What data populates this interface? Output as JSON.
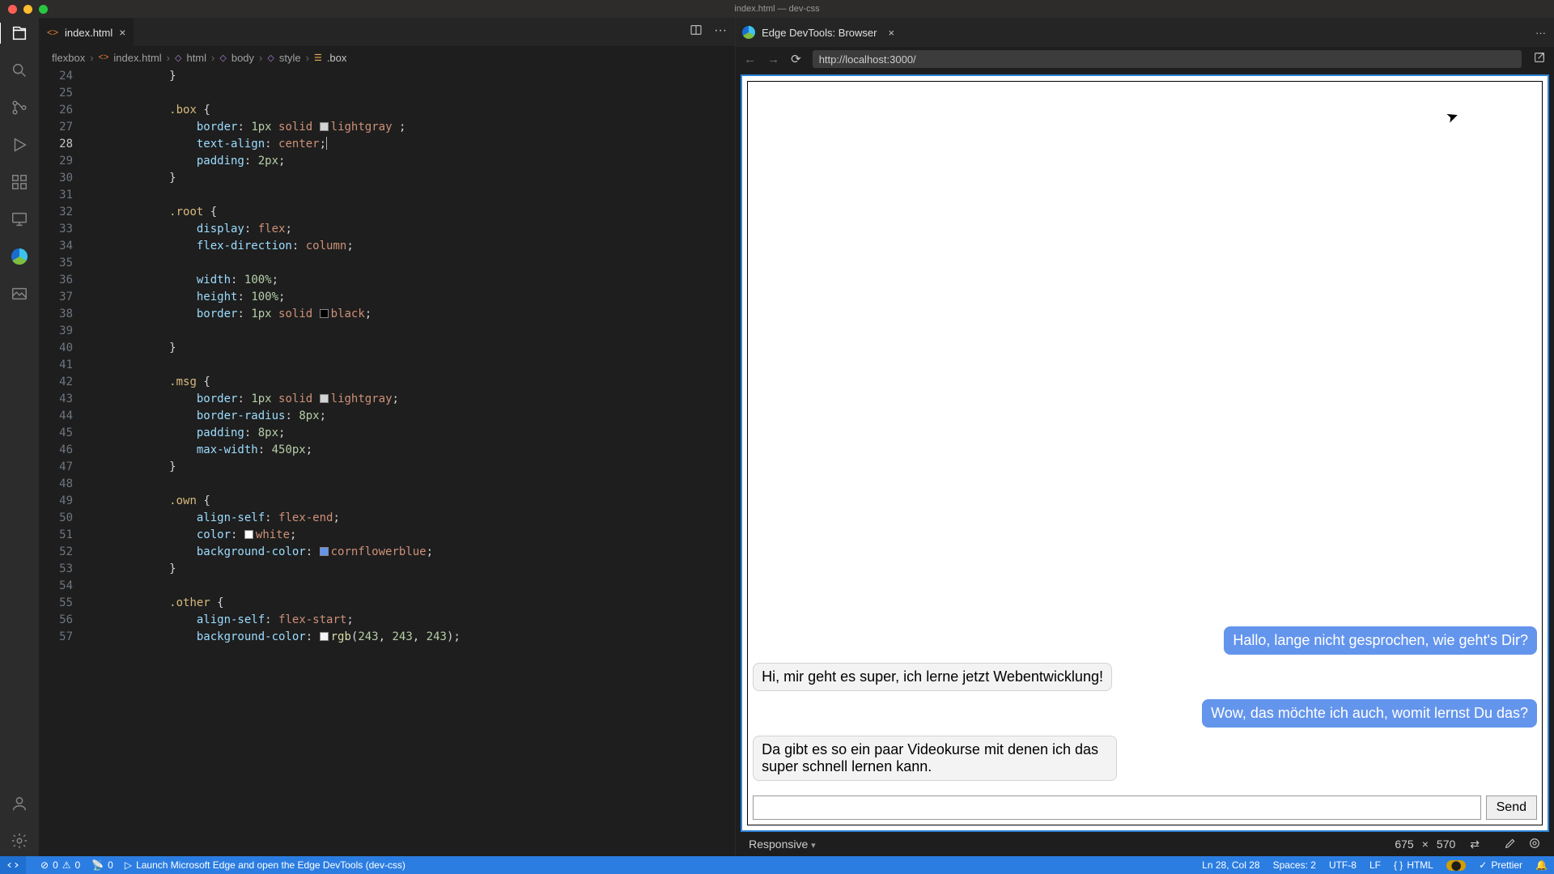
{
  "window": {
    "title": "index.html — dev-css"
  },
  "tabs": {
    "editor": {
      "label": "index.html",
      "icon": "code"
    },
    "devtools": {
      "label": "Edge DevTools: Browser"
    }
  },
  "breadcrumb": {
    "segments": [
      "flexbox",
      "index.html",
      "html",
      "body",
      "style",
      ".box"
    ]
  },
  "editor": {
    "lines_start": 24,
    "lines": [
      {
        "n": 24,
        "indent": 3,
        "t": [
          {
            "c": "brace",
            "v": "}"
          }
        ]
      },
      {
        "n": 25,
        "indent": 0,
        "t": []
      },
      {
        "n": 26,
        "indent": 3,
        "t": [
          {
            "c": "sel",
            "v": ".box"
          },
          {
            "c": "sp",
            "v": " "
          },
          {
            "c": "brace",
            "v": "{"
          }
        ]
      },
      {
        "n": 27,
        "indent": 4,
        "t": [
          {
            "c": "prop",
            "v": "border"
          },
          {
            "c": "punc",
            "v": ":"
          },
          {
            "c": "sp",
            "v": " "
          },
          {
            "c": "num",
            "v": "1px"
          },
          {
            "c": "sp",
            "v": " "
          },
          {
            "c": "val",
            "v": "solid"
          },
          {
            "c": "sp",
            "v": " "
          },
          {
            "c": "swatch",
            "v": "#d3d3d3"
          },
          {
            "c": "ident",
            "v": "lightgray"
          },
          {
            "c": "sp",
            "v": " "
          },
          {
            "c": "punc",
            "v": ";"
          }
        ]
      },
      {
        "n": 28,
        "indent": 4,
        "current": true,
        "t": [
          {
            "c": "prop",
            "v": "text-align"
          },
          {
            "c": "punc",
            "v": ":"
          },
          {
            "c": "sp",
            "v": " "
          },
          {
            "c": "val",
            "v": "center"
          },
          {
            "c": "punc",
            "v": ";"
          },
          {
            "c": "caret",
            "v": ""
          }
        ]
      },
      {
        "n": 29,
        "indent": 4,
        "t": [
          {
            "c": "prop",
            "v": "padding"
          },
          {
            "c": "punc",
            "v": ":"
          },
          {
            "c": "sp",
            "v": " "
          },
          {
            "c": "num",
            "v": "2px"
          },
          {
            "c": "punc",
            "v": ";"
          }
        ]
      },
      {
        "n": 30,
        "indent": 3,
        "t": [
          {
            "c": "brace",
            "v": "}"
          }
        ]
      },
      {
        "n": 31,
        "indent": 0,
        "t": []
      },
      {
        "n": 32,
        "indent": 3,
        "t": [
          {
            "c": "sel",
            "v": ".root"
          },
          {
            "c": "sp",
            "v": " "
          },
          {
            "c": "brace",
            "v": "{"
          }
        ]
      },
      {
        "n": 33,
        "indent": 4,
        "t": [
          {
            "c": "prop",
            "v": "display"
          },
          {
            "c": "punc",
            "v": ":"
          },
          {
            "c": "sp",
            "v": " "
          },
          {
            "c": "val",
            "v": "flex"
          },
          {
            "c": "punc",
            "v": ";"
          }
        ]
      },
      {
        "n": 34,
        "indent": 4,
        "t": [
          {
            "c": "prop",
            "v": "flex-direction"
          },
          {
            "c": "punc",
            "v": ":"
          },
          {
            "c": "sp",
            "v": " "
          },
          {
            "c": "val",
            "v": "column"
          },
          {
            "c": "punc",
            "v": ";"
          }
        ]
      },
      {
        "n": 35,
        "indent": 0,
        "t": []
      },
      {
        "n": 36,
        "indent": 4,
        "t": [
          {
            "c": "prop",
            "v": "width"
          },
          {
            "c": "punc",
            "v": ":"
          },
          {
            "c": "sp",
            "v": " "
          },
          {
            "c": "num",
            "v": "100%"
          },
          {
            "c": "punc",
            "v": ";"
          }
        ]
      },
      {
        "n": 37,
        "indent": 4,
        "t": [
          {
            "c": "prop",
            "v": "height"
          },
          {
            "c": "punc",
            "v": ":"
          },
          {
            "c": "sp",
            "v": " "
          },
          {
            "c": "num",
            "v": "100%"
          },
          {
            "c": "punc",
            "v": ";"
          }
        ]
      },
      {
        "n": 38,
        "indent": 4,
        "t": [
          {
            "c": "prop",
            "v": "border"
          },
          {
            "c": "punc",
            "v": ":"
          },
          {
            "c": "sp",
            "v": " "
          },
          {
            "c": "num",
            "v": "1px"
          },
          {
            "c": "sp",
            "v": " "
          },
          {
            "c": "val",
            "v": "solid"
          },
          {
            "c": "sp",
            "v": " "
          },
          {
            "c": "swatch",
            "v": "#000000"
          },
          {
            "c": "ident",
            "v": "black"
          },
          {
            "c": "punc",
            "v": ";"
          }
        ]
      },
      {
        "n": 39,
        "indent": 0,
        "t": []
      },
      {
        "n": 40,
        "indent": 3,
        "t": [
          {
            "c": "brace",
            "v": "}"
          }
        ]
      },
      {
        "n": 41,
        "indent": 0,
        "t": []
      },
      {
        "n": 42,
        "indent": 3,
        "t": [
          {
            "c": "sel",
            "v": ".msg"
          },
          {
            "c": "sp",
            "v": " "
          },
          {
            "c": "brace",
            "v": "{"
          }
        ]
      },
      {
        "n": 43,
        "indent": 4,
        "t": [
          {
            "c": "prop",
            "v": "border"
          },
          {
            "c": "punc",
            "v": ":"
          },
          {
            "c": "sp",
            "v": " "
          },
          {
            "c": "num",
            "v": "1px"
          },
          {
            "c": "sp",
            "v": " "
          },
          {
            "c": "val",
            "v": "solid"
          },
          {
            "c": "sp",
            "v": " "
          },
          {
            "c": "swatch",
            "v": "#d3d3d3"
          },
          {
            "c": "ident",
            "v": "lightgray"
          },
          {
            "c": "punc",
            "v": ";"
          }
        ]
      },
      {
        "n": 44,
        "indent": 4,
        "t": [
          {
            "c": "prop",
            "v": "border-radius"
          },
          {
            "c": "punc",
            "v": ":"
          },
          {
            "c": "sp",
            "v": " "
          },
          {
            "c": "num",
            "v": "8px"
          },
          {
            "c": "punc",
            "v": ";"
          }
        ]
      },
      {
        "n": 45,
        "indent": 4,
        "t": [
          {
            "c": "prop",
            "v": "padding"
          },
          {
            "c": "punc",
            "v": ":"
          },
          {
            "c": "sp",
            "v": " "
          },
          {
            "c": "num",
            "v": "8px"
          },
          {
            "c": "punc",
            "v": ";"
          }
        ]
      },
      {
        "n": 46,
        "indent": 4,
        "t": [
          {
            "c": "prop",
            "v": "max-width"
          },
          {
            "c": "punc",
            "v": ":"
          },
          {
            "c": "sp",
            "v": " "
          },
          {
            "c": "num",
            "v": "450px"
          },
          {
            "c": "punc",
            "v": ";"
          }
        ]
      },
      {
        "n": 47,
        "indent": 3,
        "t": [
          {
            "c": "brace",
            "v": "}"
          }
        ]
      },
      {
        "n": 48,
        "indent": 0,
        "t": []
      },
      {
        "n": 49,
        "indent": 3,
        "t": [
          {
            "c": "sel",
            "v": ".own"
          },
          {
            "c": "sp",
            "v": " "
          },
          {
            "c": "brace",
            "v": "{"
          }
        ]
      },
      {
        "n": 50,
        "indent": 4,
        "t": [
          {
            "c": "prop",
            "v": "align-self"
          },
          {
            "c": "punc",
            "v": ":"
          },
          {
            "c": "sp",
            "v": " "
          },
          {
            "c": "val",
            "v": "flex-end"
          },
          {
            "c": "punc",
            "v": ";"
          }
        ]
      },
      {
        "n": 51,
        "indent": 4,
        "t": [
          {
            "c": "prop",
            "v": "color"
          },
          {
            "c": "punc",
            "v": ":"
          },
          {
            "c": "sp",
            "v": " "
          },
          {
            "c": "swatch",
            "v": "#ffffff"
          },
          {
            "c": "ident",
            "v": "white"
          },
          {
            "c": "punc",
            "v": ";"
          }
        ]
      },
      {
        "n": 52,
        "indent": 4,
        "t": [
          {
            "c": "prop",
            "v": "background-color"
          },
          {
            "c": "punc",
            "v": ":"
          },
          {
            "c": "sp",
            "v": " "
          },
          {
            "c": "swatch",
            "v": "#6495ed"
          },
          {
            "c": "ident",
            "v": "cornflowerblue"
          },
          {
            "c": "punc",
            "v": ";"
          }
        ]
      },
      {
        "n": 53,
        "indent": 3,
        "t": [
          {
            "c": "brace",
            "v": "}"
          }
        ]
      },
      {
        "n": 54,
        "indent": 0,
        "t": []
      },
      {
        "n": 55,
        "indent": 3,
        "t": [
          {
            "c": "sel",
            "v": ".other"
          },
          {
            "c": "sp",
            "v": " "
          },
          {
            "c": "brace",
            "v": "{"
          }
        ]
      },
      {
        "n": 56,
        "indent": 4,
        "t": [
          {
            "c": "prop",
            "v": "align-self"
          },
          {
            "c": "punc",
            "v": ":"
          },
          {
            "c": "sp",
            "v": " "
          },
          {
            "c": "val",
            "v": "flex-start"
          },
          {
            "c": "punc",
            "v": ";"
          }
        ]
      },
      {
        "n": 57,
        "indent": 4,
        "t": [
          {
            "c": "prop",
            "v": "background-color"
          },
          {
            "c": "punc",
            "v": ":"
          },
          {
            "c": "sp",
            "v": " "
          },
          {
            "c": "swatch",
            "v": "#f3f3f3"
          },
          {
            "c": "func",
            "v": "rgb"
          },
          {
            "c": "punc",
            "v": "("
          },
          {
            "c": "num",
            "v": "243"
          },
          {
            "c": "punc",
            "v": ", "
          },
          {
            "c": "num",
            "v": "243"
          },
          {
            "c": "punc",
            "v": ", "
          },
          {
            "c": "num",
            "v": "243"
          },
          {
            "c": "punc",
            "v": ")"
          },
          {
            "c": "punc",
            "v": ";"
          }
        ]
      }
    ]
  },
  "browser": {
    "url": "http://localhost:3000/",
    "device": "Responsive",
    "width": "675",
    "height": "570"
  },
  "chat": {
    "messages": [
      {
        "side": "own",
        "text": "Hallo, lange nicht gesprochen, wie geht's Dir?"
      },
      {
        "side": "other",
        "text": "Hi, mir geht es super, ich lerne jetzt Webentwicklung!"
      },
      {
        "side": "own",
        "text": "Wow, das möchte ich auch, womit lernst Du das?"
      },
      {
        "side": "other",
        "text": "Da gibt es so ein paar Videokurse mit denen ich das super schnell lernen kann."
      }
    ],
    "send_label": "Send"
  },
  "status": {
    "errors": "0",
    "warnings": "0",
    "port": "0",
    "launch_msg": "Launch Microsoft Edge and open the Edge DevTools (dev-css)",
    "cursor": "Ln 28, Col 28",
    "spaces": "Spaces: 2",
    "encoding": "UTF-8",
    "eol": "LF",
    "lang": "HTML",
    "prettier": "Prettier"
  }
}
